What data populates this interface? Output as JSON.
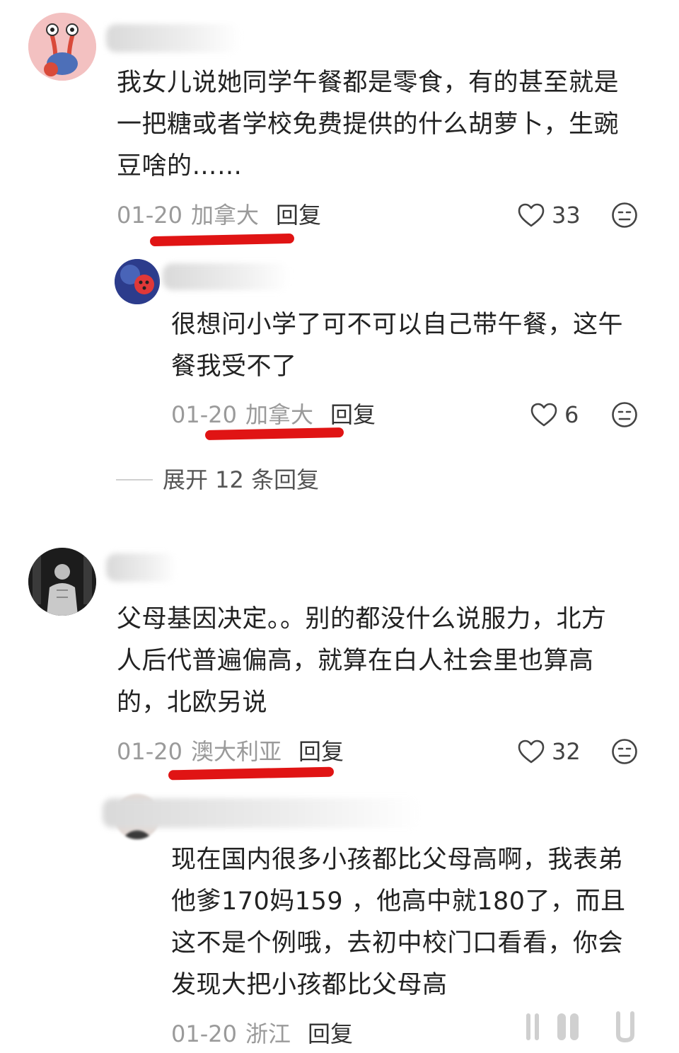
{
  "colors": {
    "underline": "#e01414",
    "meta": "#9a9a9a",
    "text": "#222222"
  },
  "comments": [
    {
      "text": "我女儿说她同学午餐都是零食，有的甚至就是\n一把糖或者学校免费提供的什么胡萝卜，生豌\n豆啥的……",
      "date": "01-20",
      "location": "加拿大",
      "reply_label": "回复",
      "likes": "33",
      "replies": [
        {
          "text": "很想问小学了可不可以自己带午餐，这午\n餐我受不了",
          "date": "01-20",
          "location": "加拿大",
          "reply_label": "回复",
          "likes": "6"
        }
      ],
      "expand_label": "展开 12 条回复"
    },
    {
      "text": "父母基因决定。。别的都没什么说服力，北方\n人后代普遍偏高，就算在白人社会里也算高\n的，北欧另说",
      "date": "01-20",
      "location": "澳大利亚",
      "reply_label": "回复",
      "likes": "32",
      "replies": [
        {
          "text": "现在国内很多小孩都比父母高啊，我表弟\n他爹170妈159 ，他高中就180了，而且\n这不是个例哦，去初中校门口看看，你会\n发现大把小孩都比父母高",
          "date": "01-20",
          "location": "浙江",
          "reply_label": "回复"
        }
      ]
    }
  ],
  "icons": {
    "heart": "heart-icon",
    "emoji": "emoji-face-icon",
    "nav": [
      "menu-icon",
      "home-icon",
      "back-icon"
    ]
  }
}
